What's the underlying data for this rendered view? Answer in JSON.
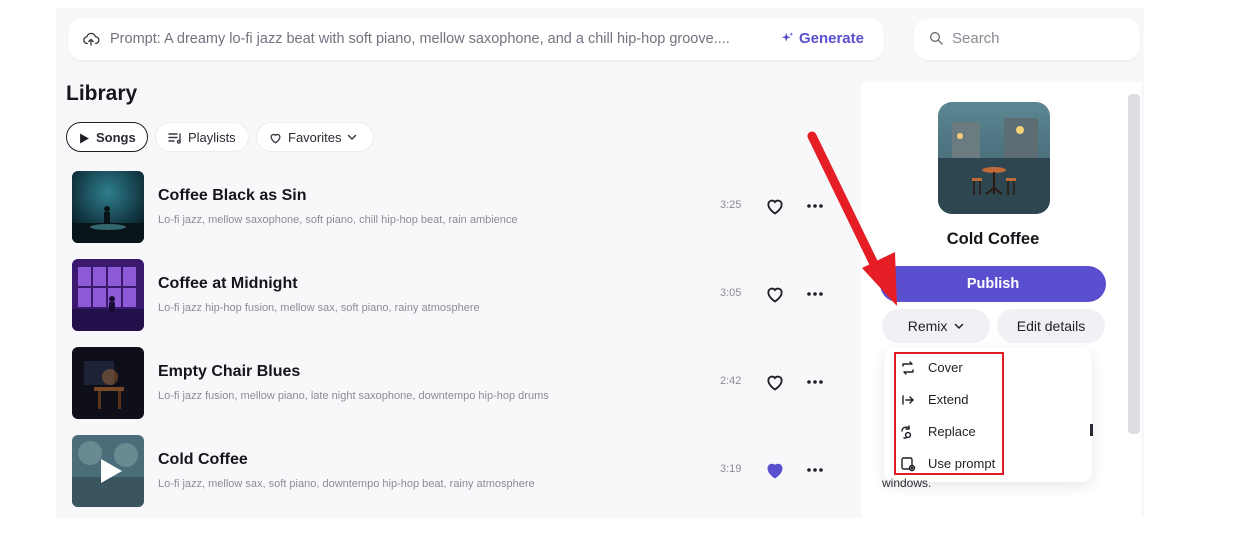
{
  "prompt": {
    "text": "Prompt: A dreamy lo-fi jazz beat with soft piano, mellow saxophone, and a chill hip-hop groove....",
    "generate_label": "Generate"
  },
  "search": {
    "placeholder": "Search"
  },
  "library": {
    "title": "Library",
    "tabs": [
      {
        "label": "Songs",
        "active": true
      },
      {
        "label": "Playlists"
      },
      {
        "label": "Favorites"
      }
    ]
  },
  "songs": [
    {
      "title": "Coffee Black as Sin",
      "tags": "Lo-fi jazz, mellow saxophone, soft piano, chill hip-hop beat, rain ambience",
      "duration": "3:25",
      "liked": false
    },
    {
      "title": "Coffee at Midnight",
      "tags": "Lo-fi jazz hip-hop fusion, mellow sax, soft piano, rainy atmosphere",
      "duration": "3:05",
      "liked": false
    },
    {
      "title": "Empty Chair Blues",
      "tags": "Lo-fi jazz fusion, mellow piano, late night saxophone, downtempo hip-hop drums",
      "duration": "2:42",
      "liked": false
    },
    {
      "title": "Cold Coffee",
      "tags": "Lo-fi jazz, mellow sax, soft piano, downtempo hip-hop beat, rainy atmosphere",
      "duration": "3:19",
      "liked": true
    }
  ],
  "panel": {
    "title": "Cold Coffee",
    "publish_label": "Publish",
    "remix_label": "Remix",
    "edit_label": "Edit details",
    "remix_menu": [
      {
        "label": "Cover",
        "icon": "cover-icon"
      },
      {
        "label": "Extend",
        "icon": "extend-icon"
      },
      {
        "label": "Replace",
        "icon": "replace-icon"
      },
      {
        "label": "Use prompt",
        "icon": "use-prompt-icon"
      }
    ],
    "trailing_text": "windows."
  },
  "colors": {
    "accent": "#5a4fcf",
    "highlight": "#e31b23"
  }
}
